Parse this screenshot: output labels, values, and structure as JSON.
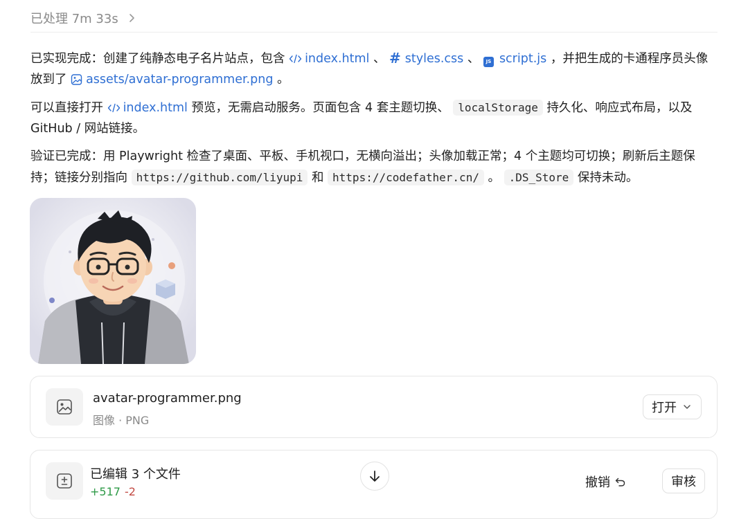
{
  "header": {
    "status": "已处理 7m 33s"
  },
  "message": {
    "p1": {
      "t1": "已实现完成：创建了纯静态电子名片站点，包含 ",
      "link1": "index.html",
      "t2": " 、 ",
      "link2": "styles.css",
      "t3": " 、 ",
      "link3": "script.js",
      "t4": " ，并把生成的卡通程序员头像放到了 ",
      "link4": "assets/avatar-programmer.png",
      "t5": " 。"
    },
    "p2": {
      "t1": "可以直接打开 ",
      "link1": "index.html",
      "t2": " 预览，无需启动服务。页面包含 4 套主题切换、 ",
      "code1": "localStorage",
      "t3": " 持久化、响应式布局，以及 GitHub / 网站链接。"
    },
    "p3": {
      "t1": "验证已完成：用 Playwright 检查了桌面、平板、手机视口，无横向溢出；头像加载正常；4 个主题均可切换；刷新后主题保持；链接分别指向 ",
      "code1": "https://github.com/liyupi",
      "t2": " 和 ",
      "code2": "https://codefather.cn/",
      "t3": " 。 ",
      "code3": ".DS_Store",
      "t4": " 保持未动。"
    },
    "js_badge": "JS"
  },
  "file_card": {
    "name": "avatar-programmer.png",
    "meta": "图像 · PNG",
    "open_label": "打开"
  },
  "edit_card": {
    "title": "已编辑 3 个文件",
    "additions": "+517",
    "deletions": "-2",
    "undo_label": "撤销",
    "review_label": "审核"
  },
  "colors": {
    "link": "#2f6fd3",
    "additions": "#2e9a47",
    "deletions": "#c24a43"
  }
}
